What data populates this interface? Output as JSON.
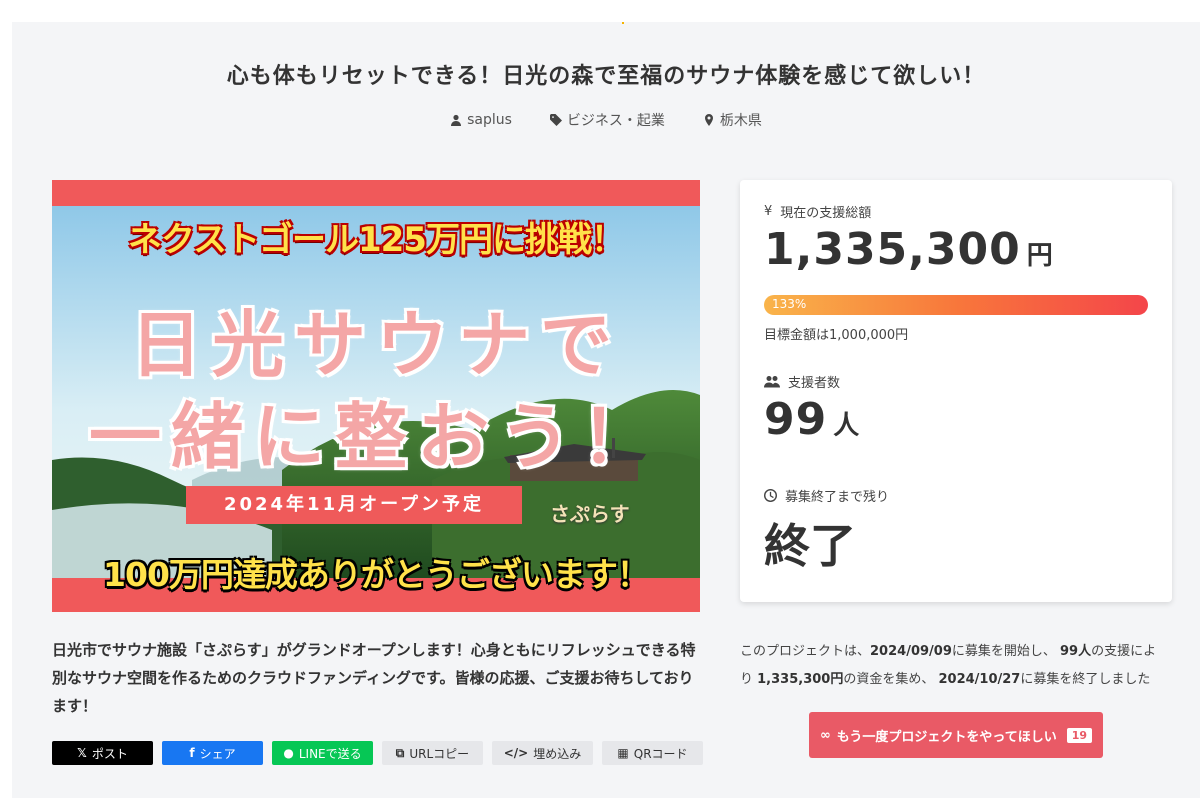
{
  "project": {
    "title": "心も体もリセットできる！日光の森で至福のサウナ体験を感じて欲しい！",
    "author": "saplus",
    "category": "ビジネス・起業",
    "location": "栃木県"
  },
  "hero": {
    "headline_top": "ネクストゴール125万円に挑戦！",
    "big_line1": "日光サウナで",
    "big_line2": "一緒に整おう！",
    "opening": "2024年11月オープン予定",
    "logo": "さぷらす",
    "bottom": "100万円達成ありがとうございます！",
    "colors": {
      "banner": "#f0595a",
      "headline": "#ffe24a"
    }
  },
  "description": "日光市でサウナ施設「さぷらす」がグランドオープンします！心身ともにリフレッシュできる特別なサウナ空間を作るためのクラウドファンディングです。皆様の応援、ご支援お待ちしております！",
  "share": {
    "post": "ポスト",
    "facebook": "シェア",
    "line": "LINEで送る",
    "url_copy": "URLコピー",
    "embed": "埋め込み",
    "qr": "QRコード"
  },
  "stats": {
    "amount_label": "現在の支援総額",
    "amount_value": "1,335,300",
    "amount_unit": "円",
    "progress_percent": 133,
    "progress_text": "133%",
    "goal_text": "目標金額は1,000,000円",
    "backers_label": "支援者数",
    "backers_value": "99",
    "backers_unit": "人",
    "remaining_label": "募集終了まで残り",
    "remaining_value": "終了"
  },
  "summary": {
    "p1": "このプロジェクトは、",
    "start_date": "2024/09/09",
    "p2": "に募集を開始し、 ",
    "backers": "99人",
    "p3": "の支援により ",
    "amount": "1,335,300円",
    "p4": "の資金を集め、 ",
    "end_date": "2024/10/27",
    "p5": "に募集を終了しました"
  },
  "again_button": {
    "label": "もう一度プロジェクトをやってほしい",
    "count": "19"
  },
  "colors": {
    "accent": "#e95a66",
    "progress_start": "#f9b44a",
    "progress_end": "#f4454a"
  }
}
